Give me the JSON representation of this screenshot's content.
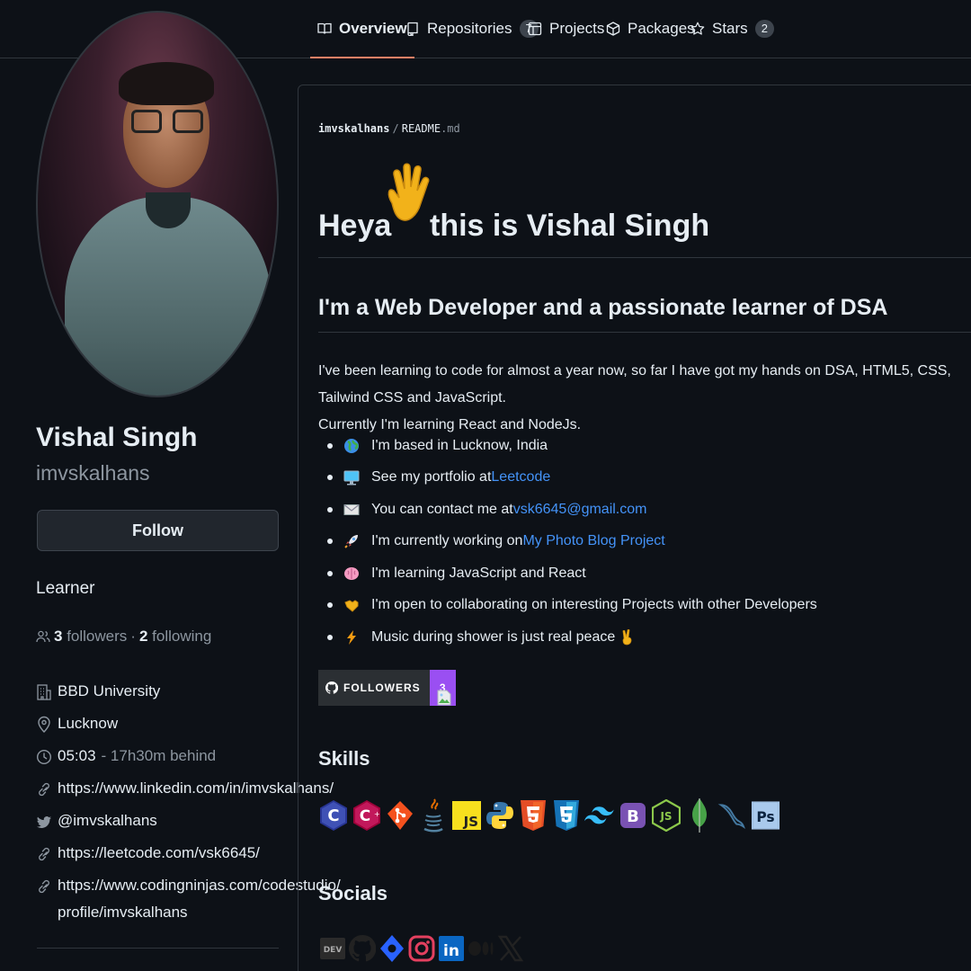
{
  "nav": {
    "tabs": [
      {
        "label": "Overview",
        "icon": "book-icon",
        "count": null
      },
      {
        "label": "Repositories",
        "icon": "repo-icon",
        "count": "7"
      },
      {
        "label": "Projects",
        "icon": "table-icon",
        "count": null
      },
      {
        "label": "Packages",
        "icon": "package-icon",
        "count": null
      },
      {
        "label": "Stars",
        "icon": "star-icon",
        "count": "2"
      }
    ],
    "active_accent": "#f78166"
  },
  "profile": {
    "name": "Vishal Singh",
    "username": "imvskalhans",
    "follow_label": "Follow",
    "bio": "Learner",
    "followers_count": "3",
    "followers_label": "followers",
    "separator": "·",
    "following_count": "2",
    "following_label": "following",
    "organization": "BBD University",
    "location": "Lucknow",
    "local_time": "05:03",
    "time_offset": "- 17h30m behind",
    "links": [
      "https://www.linkedin.com/in/imvskalhans/",
      "@imvskalhans",
      "https://leetcode.com/vsk6645/",
      "https://www.codingninjas.com/codestudio/",
      "profile/imvskalhans"
    ]
  },
  "readme": {
    "owner": "imvskalhans",
    "slash": "/",
    "file": "README",
    "ext": ".md",
    "heading_part1": "Heya",
    "heading_part2": "this is Vishal Singh",
    "subheading": "I'm a Web Developer and a passionate learner of DSA",
    "intro_line1": "I've been learning to code for almost a year now, so far I have got my hands on DSA, HTML5, CSS, Tailwind CSS and JavaScript.",
    "intro_line2": "Currently I'm learning React and NodeJs.",
    "items": [
      {
        "emoji": "globe-icon",
        "text": "I'm based in Lucknow, India",
        "link": ""
      },
      {
        "emoji": "desktop-icon",
        "text": "See my portfolio at ",
        "link": "Leetcode"
      },
      {
        "emoji": "envelope-icon",
        "text": "You can contact me at ",
        "link": "vsk6645@gmail.com"
      },
      {
        "emoji": "rocket-icon",
        "text": "I'm currently working on ",
        "link": "My Photo Blog Project"
      },
      {
        "emoji": "brain-icon",
        "text": "I'm learning JavaScript and React",
        "link": ""
      },
      {
        "emoji": "handshake-icon",
        "text": "I'm open to collaborating on interesting Projects with other Developers",
        "link": ""
      },
      {
        "emoji": "lightning-icon",
        "text": "Music during shower is just real peace",
        "link": ""
      }
    ],
    "badge_label": "FOLLOWERS",
    "badge_count": "3",
    "badge_color": "#9a4ff2",
    "skills_heading": "Skills",
    "skills": [
      "c-icon",
      "cplusplus-icon",
      "git-icon",
      "java-icon",
      "javascript-icon",
      "python-icon",
      "html5-icon",
      "css3-icon",
      "tailwind-icon",
      "bootstrap-icon",
      "nodejs-icon",
      "mongodb-icon",
      "mysql-icon",
      "photoshop-icon"
    ],
    "socials_heading": "Socials",
    "socials": [
      "dev-icon",
      "github-icon",
      "hashnode-icon",
      "instagram-icon",
      "linkedin-icon",
      "medium-icon",
      "x-icon"
    ],
    "dev_text": "DEV"
  }
}
